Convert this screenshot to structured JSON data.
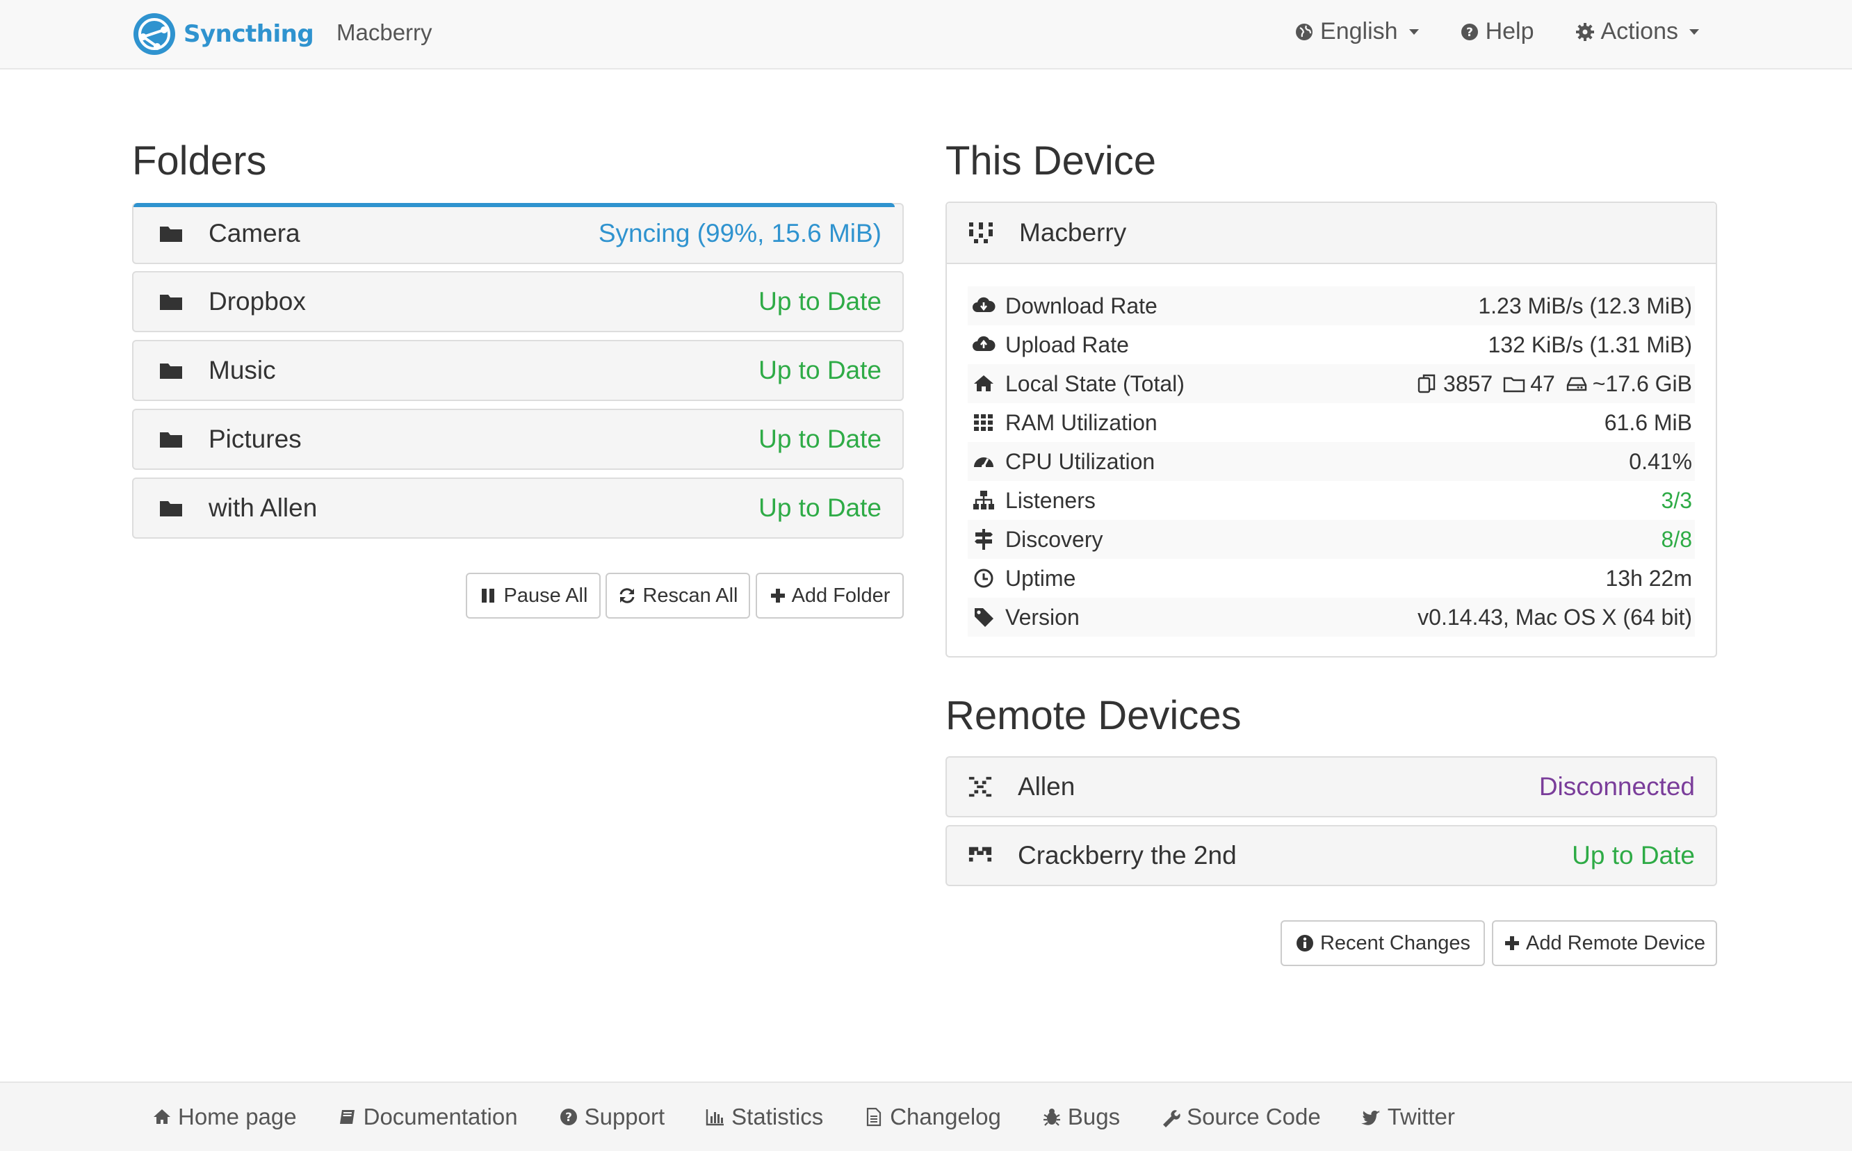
{
  "navbar": {
    "brand": "Syncthing",
    "device_name": "Macberry",
    "language": "English",
    "help": "Help",
    "actions": "Actions"
  },
  "folders": {
    "title": "Folders",
    "items": [
      {
        "name": "Camera",
        "status": "Syncing (99%, 15.6 MiB)",
        "progress": 0.99
      },
      {
        "name": "Dropbox",
        "status": "Up to Date"
      },
      {
        "name": "Music",
        "status": "Up to Date"
      },
      {
        "name": "Pictures",
        "status": "Up to Date"
      },
      {
        "name": "with Allen",
        "status": "Up to Date"
      }
    ],
    "buttons": {
      "pause_all": "Pause All",
      "rescan_all": "Rescan All",
      "add_folder": "Add Folder"
    }
  },
  "this_device": {
    "title": "This Device",
    "name": "Macberry",
    "stats": [
      {
        "label": "Download Rate",
        "value": "1.23 MiB/s (12.3 MiB)"
      },
      {
        "label": "Upload Rate",
        "value": "132 KiB/s (1.31 MiB)"
      },
      {
        "label": "Local State (Total)",
        "files": "3857",
        "dirs": "47",
        "size": "~17.6 GiB"
      },
      {
        "label": "RAM Utilization",
        "value": "61.6 MiB"
      },
      {
        "label": "CPU Utilization",
        "value": "0.41%"
      },
      {
        "label": "Listeners",
        "value": "3/3"
      },
      {
        "label": "Discovery",
        "value": "8/8"
      },
      {
        "label": "Uptime",
        "value": "13h 22m"
      },
      {
        "label": "Version",
        "value": "v0.14.43, Mac OS X (64 bit)"
      }
    ]
  },
  "remote_devices": {
    "title": "Remote Devices",
    "items": [
      {
        "name": "Allen",
        "status": "Disconnected"
      },
      {
        "name": "Crackberry the 2nd",
        "status": "Up to Date"
      }
    ],
    "buttons": {
      "recent_changes": "Recent Changes",
      "add_remote_device": "Add Remote Device"
    }
  },
  "footer": {
    "links": [
      "Home page",
      "Documentation",
      "Support",
      "Statistics",
      "Changelog",
      "Bugs",
      "Source Code",
      "Twitter"
    ]
  },
  "colors": {
    "brand": "#2f93cf",
    "up_to_date": "#2eab46",
    "syncing": "#2f93cf",
    "disconnected": "#7a3d9a"
  }
}
